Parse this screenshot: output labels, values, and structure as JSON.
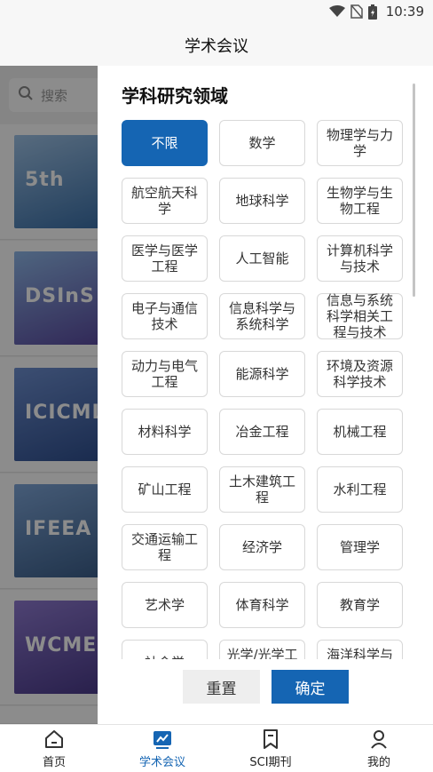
{
  "status_bar": {
    "time": "10:39"
  },
  "header": {
    "title": "学术会议"
  },
  "search": {
    "placeholder": "搜索"
  },
  "conference_thumbs": [
    {
      "text": "5th",
      "color": "#3a6fa8"
    },
    {
      "text": "DSInS",
      "color": "#5a4aa0"
    },
    {
      "text": "ICICML",
      "color": "#2f4f8f"
    },
    {
      "text": "IFEEA",
      "color": "#3b5e8a"
    },
    {
      "text": "WCME",
      "color": "#4a3a8a"
    }
  ],
  "drawer": {
    "title": "学科研究领域",
    "fields": [
      {
        "label": "不限",
        "selected": true
      },
      {
        "label": "数学"
      },
      {
        "label": "物理学与力学"
      },
      {
        "label": "航空航天科学"
      },
      {
        "label": "地球科学"
      },
      {
        "label": "生物学与生物工程"
      },
      {
        "label": "医学与医学工程"
      },
      {
        "label": "人工智能"
      },
      {
        "label": "计算机科学与技术"
      },
      {
        "label": "电子与通信技术"
      },
      {
        "label": "信息科学与系统科学"
      },
      {
        "label": "信息与系统科学相关工程与技术"
      },
      {
        "label": "动力与电气工程"
      },
      {
        "label": "能源科学"
      },
      {
        "label": "环境及资源科学技术"
      },
      {
        "label": "材料科学"
      },
      {
        "label": "冶金工程"
      },
      {
        "label": "机械工程"
      },
      {
        "label": "矿山工程"
      },
      {
        "label": "土木建筑工程"
      },
      {
        "label": "水利工程"
      },
      {
        "label": "交通运输工程"
      },
      {
        "label": "经济学"
      },
      {
        "label": "管理学"
      },
      {
        "label": "艺术学"
      },
      {
        "label": "体育科学"
      },
      {
        "label": "教育学"
      },
      {
        "label": "社会学"
      },
      {
        "label": "光学/光学工程"
      },
      {
        "label": "海洋科学与技术"
      }
    ],
    "reset_label": "重置",
    "confirm_label": "确定"
  },
  "bottom_nav": [
    {
      "label": "首页",
      "icon": "home-icon"
    },
    {
      "label": "学术会议",
      "icon": "conference-icon",
      "active": true
    },
    {
      "label": "SCI期刊",
      "icon": "bookmark-icon"
    },
    {
      "label": "我的",
      "icon": "user-icon"
    }
  ],
  "colors": {
    "accent": "#1565b3"
  }
}
